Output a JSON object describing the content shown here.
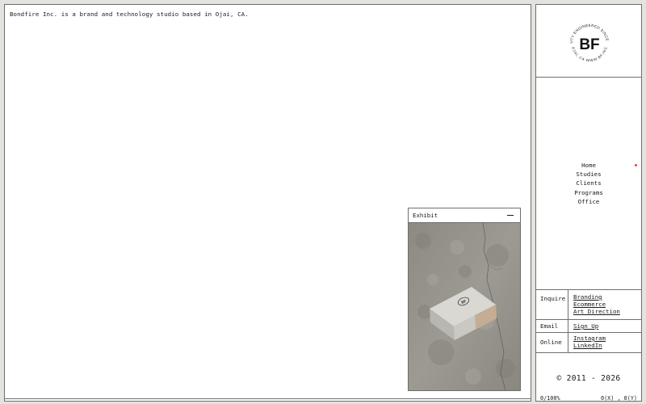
{
  "intro_text": "Bondfire Inc. is a brand and technology studio based in Ojai, CA.",
  "exhibit": {
    "title": "Exhibit",
    "image_label": "BF"
  },
  "logo": {
    "monogram": "BF",
    "ring_top": "BEAUTY ENGINEERED SINCE 2011",
    "ring_bottom": "OJAI, CA  WWW.BF.INC"
  },
  "nav": {
    "items": [
      "Home",
      "Studies",
      "Clients",
      "Programs",
      "Office"
    ],
    "active": "Home",
    "active_color": "#e2463a"
  },
  "contact": {
    "inquire": {
      "label": "Inquire",
      "links": [
        "Branding",
        "Ecommerce",
        "Art Direction"
      ]
    },
    "email": {
      "label": "Email",
      "links": [
        "Sign Up"
      ]
    },
    "online": {
      "label": "Online",
      "links": [
        "Instagram",
        "LinkedIn"
      ]
    }
  },
  "footer": {
    "copyright": "© 2011 - 2026",
    "progress": "0/100%",
    "coords": "0(X) , 0(Y)"
  }
}
